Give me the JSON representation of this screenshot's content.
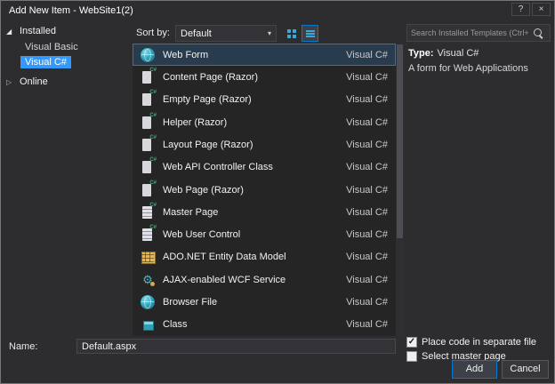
{
  "window": {
    "title": "Add New Item - WebSite1(2)",
    "help_glyph": "?",
    "close_glyph": "×"
  },
  "sidebar": {
    "installed": {
      "label": "Installed",
      "arrow": "◢"
    },
    "installed_items": [
      {
        "label": "Visual Basic",
        "selected": false
      },
      {
        "label": "Visual C#",
        "selected": true
      }
    ],
    "online": {
      "label": "Online",
      "arrow": "▷"
    }
  },
  "toolbar": {
    "sort_label": "Sort by:",
    "sort_value": "Default",
    "dropdown_arrow": "▾"
  },
  "templates": [
    {
      "name": "Web Form",
      "language": "Visual C#",
      "icon": "globe",
      "selected": true
    },
    {
      "name": "Content Page (Razor)",
      "language": "Visual C#",
      "icon": "razor-doc",
      "selected": false
    },
    {
      "name": "Empty Page (Razor)",
      "language": "Visual C#",
      "icon": "razor-doc",
      "selected": false
    },
    {
      "name": "Helper (Razor)",
      "language": "Visual C#",
      "icon": "razor-doc",
      "selected": false
    },
    {
      "name": "Layout Page (Razor)",
      "language": "Visual C#",
      "icon": "razor-doc",
      "selected": false
    },
    {
      "name": "Web API Controller Class",
      "language": "Visual C#",
      "icon": "api-doc",
      "selected": false
    },
    {
      "name": "Web Page (Razor)",
      "language": "Visual C#",
      "icon": "razor-doc",
      "selected": false
    },
    {
      "name": "Master Page",
      "language": "Visual C#",
      "icon": "master-page",
      "selected": false
    },
    {
      "name": "Web User Control",
      "language": "Visual C#",
      "icon": "user-control",
      "selected": false
    },
    {
      "name": "ADO.NET Entity Data Model",
      "language": "Visual C#",
      "icon": "entity-model",
      "selected": false
    },
    {
      "name": "AJAX-enabled WCF Service",
      "language": "Visual C#",
      "icon": "wcf-gear",
      "selected": false
    },
    {
      "name": "Browser File",
      "language": "Visual C#",
      "icon": "browser-globe",
      "selected": false
    },
    {
      "name": "Class",
      "language": "Visual C#",
      "icon": "class-cube",
      "selected": false
    }
  ],
  "search": {
    "placeholder": "Search Installed Templates (Ctrl+E)"
  },
  "details": {
    "type_label": "Type:",
    "type_value": "Visual C#",
    "description": "A form for Web Applications"
  },
  "footer": {
    "name_label": "Name:",
    "name_value": "Default.aspx",
    "checkboxes": [
      {
        "label": "Place code in separate file",
        "checked": true,
        "mark": "✓"
      },
      {
        "label": "Select master page",
        "checked": false,
        "mark": ""
      }
    ],
    "add_label": "Add",
    "cancel_label": "Cancel"
  },
  "colors": {
    "accent": "#007acc",
    "selection_blue": "#3399ff",
    "icon_teal": "#3fb7c9"
  }
}
